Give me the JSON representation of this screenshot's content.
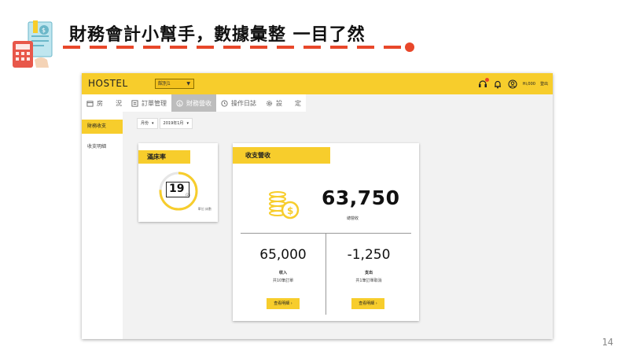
{
  "slide": {
    "title": "財務會計小幫手，數據彙整 一目了然",
    "page_number": "14"
  },
  "app": {
    "brand": "HOSTEL",
    "branch": {
      "selected": "館別1"
    },
    "user_label": "Hi,000",
    "logout_label": "登出",
    "tabs": [
      {
        "label": "房　　況",
        "icon": "calendar-icon",
        "active": false
      },
      {
        "label": "訂單管理",
        "icon": "list-icon",
        "active": false
      },
      {
        "label": "財務營收",
        "icon": "dollar-icon",
        "active": true
      },
      {
        "label": "操作日誌",
        "icon": "history-icon",
        "active": false
      },
      {
        "label": "設　　定",
        "icon": "gear-icon",
        "active": false
      }
    ],
    "sidebar": [
      {
        "label": "財務收支",
        "active": true
      },
      {
        "label": "收支明細",
        "active": false
      }
    ],
    "filters": {
      "period": "月份",
      "month": "2019年1月"
    },
    "occupancy": {
      "title": "滿床率",
      "value": "19",
      "unit": "/25",
      "note": "單位:床數",
      "fraction": 0.76
    },
    "revenue": {
      "title": "收支營收",
      "total": "63,750",
      "total_label": "總營收",
      "income": {
        "value": "65,000",
        "label": "收入",
        "sub": "共10筆訂單",
        "button": "查看明細"
      },
      "expense": {
        "value": "-1,250",
        "label": "支出",
        "sub": "共1筆訂單取消",
        "button": "查看明細"
      }
    },
    "colors": {
      "accent": "#f7cd2c",
      "alert": "#e8472a"
    }
  }
}
